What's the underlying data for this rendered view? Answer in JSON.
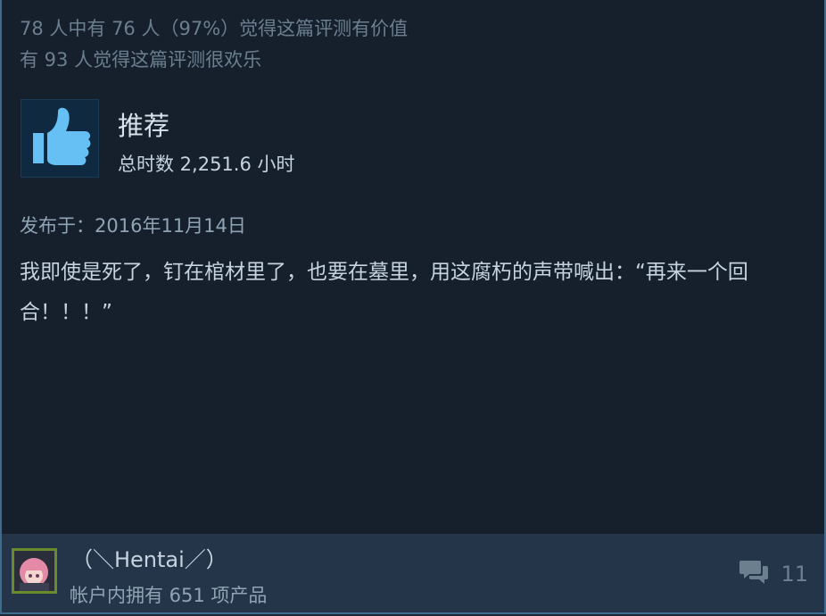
{
  "helpful": {
    "line1": "78 人中有 76 人（97%）觉得这篇评测有价值",
    "line2": "有 93 人觉得这篇评测很欢乐"
  },
  "review": {
    "verdict": "推荐",
    "icon": "thumbs-up-icon",
    "hours": "总时数 2,251.6 小时",
    "posted": "发布于：2016年11月14日",
    "text": "我即使是死了，钉在棺材里了，也要在墓里，用这腐朽的声带喊出：“再来一个回合！！！”"
  },
  "author": {
    "name": "（＼Hentai／）",
    "products": "帐户内拥有 651 项产品",
    "avatar": "avatar-anime-girl"
  },
  "comments": {
    "icon": "comment-bubbles-icon",
    "count": "11"
  },
  "colors": {
    "background": "#16202d",
    "footer": "#253549",
    "thumb_blue": "#66c0f4",
    "border": "#3d6c8d"
  }
}
